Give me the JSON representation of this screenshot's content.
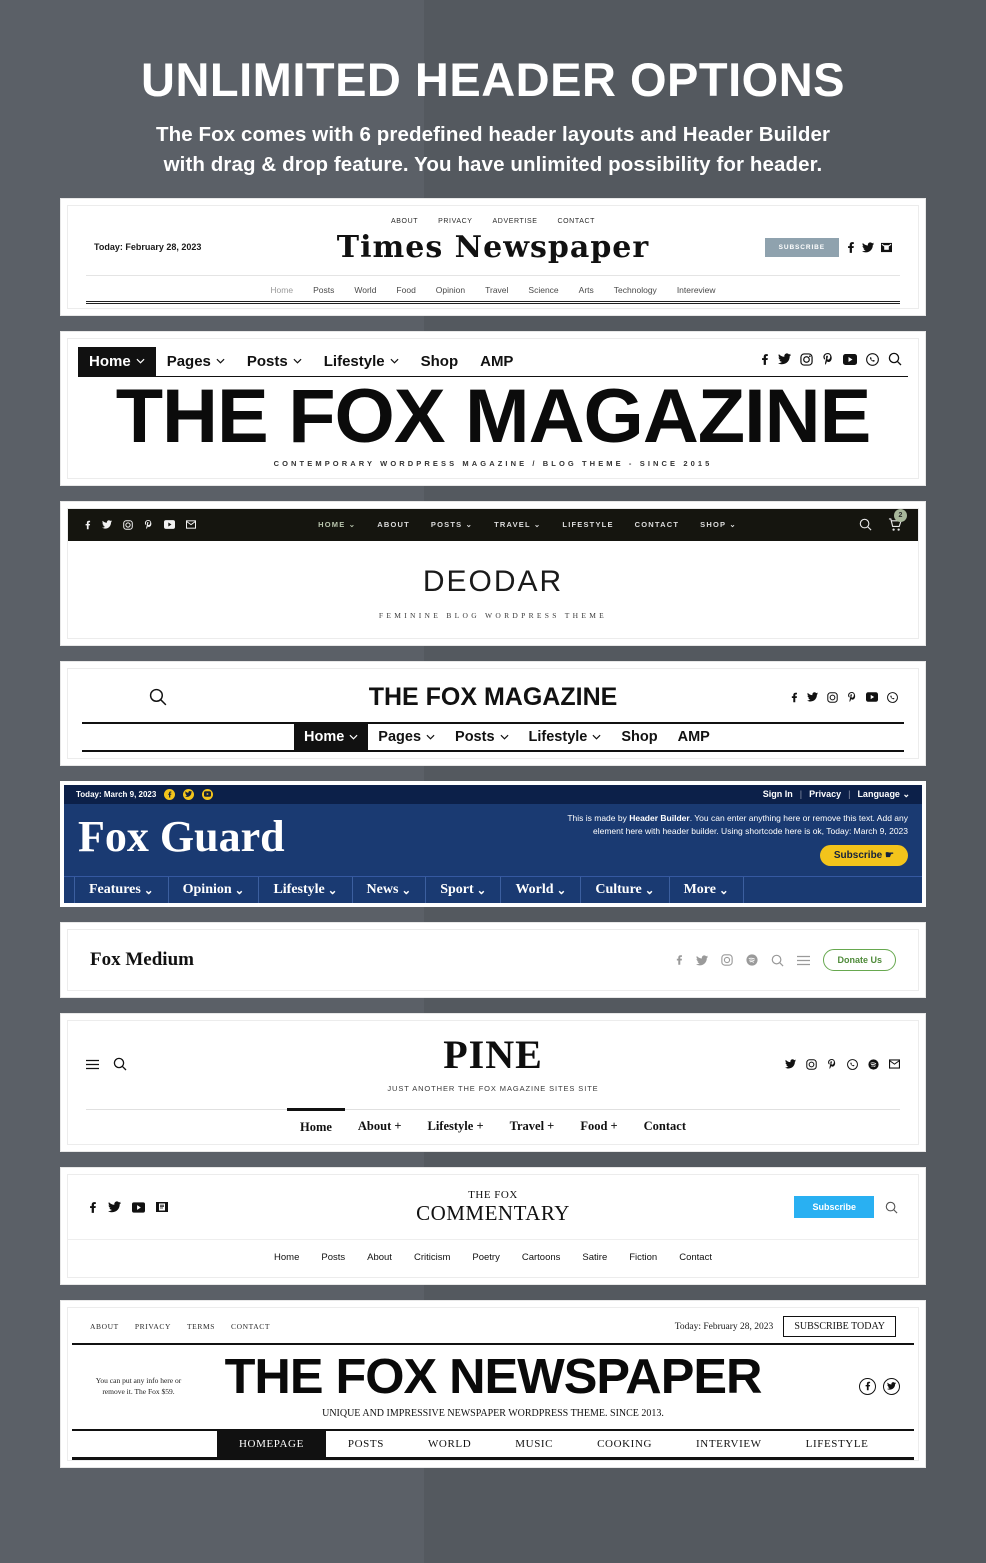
{
  "hero": {
    "title": "UNLIMITED HEADER OPTIONS",
    "subtitle_line1": "The Fox comes with 6 predefined header layouts and Header Builder",
    "subtitle_line2": "with drag & drop feature. You have unlimited possibility for header."
  },
  "header1": {
    "top_links": [
      "ABOUT",
      "PRIVACY",
      "ADVERTISE",
      "CONTACT"
    ],
    "date": "Today: February 28, 2023",
    "logo": "Times  Newspaper",
    "subscribe_label": "SUBSCRIBE",
    "subscribe_color": "#8fa2ae",
    "social": [
      "facebook-icon",
      "twitter-icon",
      "email-icon"
    ],
    "nav": [
      "Home",
      "Posts",
      "World",
      "Food",
      "Opinion",
      "Travel",
      "Science",
      "Arts",
      "Technology",
      "Intereview"
    ]
  },
  "header2": {
    "menu": [
      {
        "label": "Home",
        "caret": true,
        "active": true
      },
      {
        "label": "Pages",
        "caret": true,
        "active": false
      },
      {
        "label": "Posts",
        "caret": true,
        "active": false
      },
      {
        "label": "Lifestyle",
        "caret": true,
        "active": false
      },
      {
        "label": "Shop",
        "caret": false,
        "active": false
      },
      {
        "label": "AMP",
        "caret": false,
        "active": false
      }
    ],
    "logo": "THE FOX MAGAZINE",
    "tagline": "CONTEMPORARY WORDPRESS MAGAZINE / BLOG THEME - SINCE 2015",
    "social": [
      "facebook-icon",
      "twitter-icon",
      "instagram-icon",
      "pinterest-icon",
      "youtube-icon",
      "whatsapp-icon",
      "search-icon"
    ]
  },
  "header3": {
    "bar_color": "#15150f",
    "social": [
      "facebook-icon",
      "twitter-icon",
      "instagram-icon",
      "pinterest-icon",
      "youtube-icon",
      "email-icon"
    ],
    "menu": [
      {
        "label": "HOME",
        "caret": true,
        "active": true
      },
      {
        "label": "ABOUT",
        "caret": false,
        "active": false
      },
      {
        "label": "POSTS",
        "caret": true,
        "active": false
      },
      {
        "label": "TRAVEL",
        "caret": true,
        "active": false
      },
      {
        "label": "LIFESTYLE",
        "caret": false,
        "active": false
      },
      {
        "label": "CONTACT",
        "caret": false,
        "active": false
      },
      {
        "label": "SHOP",
        "caret": true,
        "active": false
      }
    ],
    "cart_count": "2",
    "cart_badge_color": "#a8b79a",
    "logo": "DEODAR",
    "tagline": "FEMININE BLOG WORDPRESS THEME"
  },
  "header4": {
    "logo": "THE FOX MAGAZINE",
    "social": [
      "facebook-icon",
      "twitter-icon",
      "instagram-icon",
      "pinterest-icon",
      "youtube-icon",
      "whatsapp-icon"
    ],
    "menu": [
      {
        "label": "Home",
        "caret": true,
        "active": true
      },
      {
        "label": "Pages",
        "caret": true,
        "active": false
      },
      {
        "label": "Posts",
        "caret": true,
        "active": false
      },
      {
        "label": "Lifestyle",
        "caret": true,
        "active": false
      },
      {
        "label": "Shop",
        "caret": false,
        "active": false
      },
      {
        "label": "AMP",
        "caret": false,
        "active": false
      }
    ]
  },
  "header5": {
    "top_bg": "#0c2049",
    "main_bg": "#1a3a72",
    "accent": "#f3c41b",
    "date": "Today: March 9, 2023",
    "social": [
      "facebook-icon",
      "twitter-icon",
      "youtube-icon"
    ],
    "top_right": [
      "Sign In",
      "Privacy",
      "Language"
    ],
    "logo": "Fox Guard",
    "blurb_a": "This is made by ",
    "blurb_b": "Header Builder",
    "blurb_c": ". You can enter anything here or remove this text. Add any element here with header builder. Using shortcode here is ok, Today: March 9, 2023",
    "subscribe_label": "Subscribe",
    "nav": [
      "Features",
      "Opinion",
      "Lifestyle",
      "News",
      "Sport",
      "World",
      "Culture",
      "More"
    ]
  },
  "header6": {
    "logo": "Fox Medium",
    "social": [
      "facebook-icon",
      "twitter-icon",
      "instagram-icon",
      "spotify-icon",
      "search-icon",
      "hamburger-icon"
    ],
    "donate_label": "Donate Us",
    "donate_color": "#4f8b3a"
  },
  "header7": {
    "logo": "PINE",
    "tagline": "JUST ANOTHER THE FOX MAGAZINE SITES SITE",
    "left_icons": [
      "hamburger-icon",
      "search-icon"
    ],
    "social": [
      "twitter-icon",
      "instagram-icon",
      "pinterest-icon",
      "whatsapp-icon",
      "spotify-icon",
      "email-icon"
    ],
    "menu": [
      {
        "label": "Home",
        "plus": false,
        "active": true
      },
      {
        "label": "About +",
        "plus": true,
        "active": false
      },
      {
        "label": "Lifestyle +",
        "plus": true,
        "active": false
      },
      {
        "label": "Travel +",
        "plus": true,
        "active": false
      },
      {
        "label": "Food +",
        "plus": true,
        "active": false
      },
      {
        "label": "Contact",
        "plus": false,
        "active": false
      }
    ]
  },
  "header8": {
    "logo_line1": "THE FOX",
    "logo_line2": "COMMENTARY",
    "social": [
      "facebook-icon",
      "twitter-icon",
      "youtube-icon",
      "email-icon"
    ],
    "subscribe_label": "Subscribe",
    "subscribe_color": "#29b0f2",
    "nav": [
      "Home",
      "Posts",
      "About",
      "Criticism",
      "Poetry",
      "Cartoons",
      "Satire",
      "Fiction",
      "Contact"
    ]
  },
  "header9": {
    "top_links": [
      "ABOUT",
      "PRIVACY",
      "TERMS",
      "CONTACT"
    ],
    "date": "Today: February 28, 2023",
    "subscribe_label": "SUBSCRIBE TODAY",
    "note": "You can put any info here or remove it. The Fox $59.",
    "logo": "THE FOX NEWSPAPER",
    "tagline": "UNIQUE AND IMPRESSIVE NEWSPAPER WORDPRESS THEME. SINCE 2013.",
    "social": [
      "facebook-icon",
      "twitter-icon"
    ],
    "nav": [
      {
        "label": "HOMEPAGE",
        "active": true
      },
      {
        "label": "POSTS",
        "active": false
      },
      {
        "label": "WORLD",
        "active": false
      },
      {
        "label": "MUSIC",
        "active": false
      },
      {
        "label": "COOKING",
        "active": false
      },
      {
        "label": "INTERVIEW",
        "active": false
      },
      {
        "label": "LIFESTYLE",
        "active": false
      }
    ]
  }
}
